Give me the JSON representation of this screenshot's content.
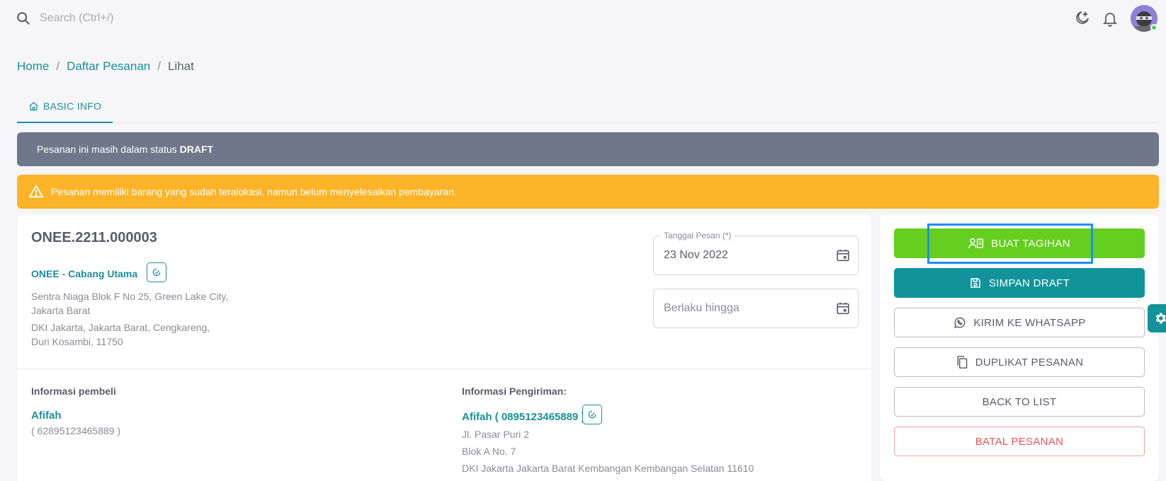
{
  "search": {
    "placeholder": "Search (Ctrl+/)"
  },
  "header": {
    "icons": [
      "moon-star-icon",
      "bell-icon",
      "avatar"
    ]
  },
  "breadcrumb": {
    "home": "Home",
    "list": "Daftar Pesanan",
    "current": "Lihat",
    "separator": "/"
  },
  "tabs": [
    {
      "label": "BASIC INFO",
      "icon": "home-icon",
      "active": true
    }
  ],
  "alerts": {
    "draft_text": "Pesanan ini masih dalam status",
    "draft_status": "DRAFT",
    "warning_text": "Pesanan memiliki barang yang sudah teralokasi, namun belum menyelesaikan pembayaran."
  },
  "order": {
    "number": "ONEE.2211.000003",
    "branch": "ONEE - Cabang Utama",
    "address_line1": "Sentra Niaga Blok F No 25, Green Lake City,",
    "address_line2": "Jakarta Barat",
    "address_line3": "DKI Jakarta, Jakarta Barat, Cengkareng,",
    "address_line4": "Duri Kosambi, 11750",
    "date_label": "Tanggal Pesan (*)",
    "date_value": "23 Nov 2022",
    "valid_until_placeholder": "Berlaku hingga"
  },
  "buyer": {
    "section_label": "Informasi pembeli",
    "name": "Afifah",
    "phone": "( 62895123465889 )"
  },
  "shipping": {
    "section_label": "Informasi Pengiriman:",
    "name": "Afifah ( 0895123465889 )",
    "line1": "Jl. Pasar Puri 2",
    "line2": "Blok A No. 7",
    "line3": "DKI Jakarta Jakarta Barat Kembangan Kembangan Selatan 11610"
  },
  "actions": {
    "invoice": "BUAT TAGIHAN",
    "save_draft": "SIMPAN DRAFT",
    "whatsapp": "KIRIM KE WHATSAPP",
    "duplicate": "DUPLIKAT PESANAN",
    "back": "BACK TO LIST",
    "cancel": "BATAL PESANAN"
  },
  "colors": {
    "primary": "#12939a",
    "success": "#64cf1e",
    "warning": "#fbb428",
    "draft_alert": "#6e788a",
    "danger": "#ea5455",
    "highlight": "#1b8ef5"
  }
}
